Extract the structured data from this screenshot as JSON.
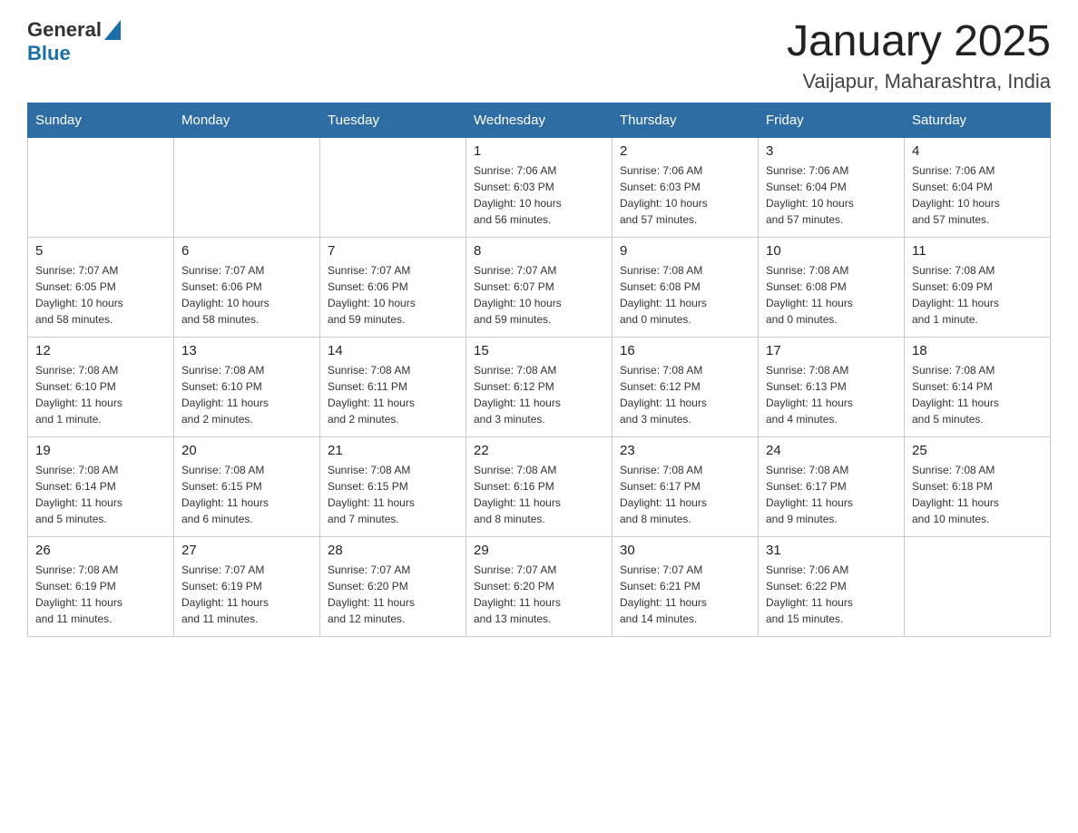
{
  "header": {
    "logo": {
      "text_general": "General",
      "text_blue": "Blue",
      "alt": "GeneralBlue logo"
    },
    "month_year": "January 2025",
    "location": "Vaijapur, Maharashtra, India"
  },
  "days_of_week": [
    "Sunday",
    "Monday",
    "Tuesday",
    "Wednesday",
    "Thursday",
    "Friday",
    "Saturday"
  ],
  "weeks": [
    {
      "days": [
        {
          "num": "",
          "info": ""
        },
        {
          "num": "",
          "info": ""
        },
        {
          "num": "",
          "info": ""
        },
        {
          "num": "1",
          "info": "Sunrise: 7:06 AM\nSunset: 6:03 PM\nDaylight: 10 hours\nand 56 minutes."
        },
        {
          "num": "2",
          "info": "Sunrise: 7:06 AM\nSunset: 6:03 PM\nDaylight: 10 hours\nand 57 minutes."
        },
        {
          "num": "3",
          "info": "Sunrise: 7:06 AM\nSunset: 6:04 PM\nDaylight: 10 hours\nand 57 minutes."
        },
        {
          "num": "4",
          "info": "Sunrise: 7:06 AM\nSunset: 6:04 PM\nDaylight: 10 hours\nand 57 minutes."
        }
      ]
    },
    {
      "days": [
        {
          "num": "5",
          "info": "Sunrise: 7:07 AM\nSunset: 6:05 PM\nDaylight: 10 hours\nand 58 minutes."
        },
        {
          "num": "6",
          "info": "Sunrise: 7:07 AM\nSunset: 6:06 PM\nDaylight: 10 hours\nand 58 minutes."
        },
        {
          "num": "7",
          "info": "Sunrise: 7:07 AM\nSunset: 6:06 PM\nDaylight: 10 hours\nand 59 minutes."
        },
        {
          "num": "8",
          "info": "Sunrise: 7:07 AM\nSunset: 6:07 PM\nDaylight: 10 hours\nand 59 minutes."
        },
        {
          "num": "9",
          "info": "Sunrise: 7:08 AM\nSunset: 6:08 PM\nDaylight: 11 hours\nand 0 minutes."
        },
        {
          "num": "10",
          "info": "Sunrise: 7:08 AM\nSunset: 6:08 PM\nDaylight: 11 hours\nand 0 minutes."
        },
        {
          "num": "11",
          "info": "Sunrise: 7:08 AM\nSunset: 6:09 PM\nDaylight: 11 hours\nand 1 minute."
        }
      ]
    },
    {
      "days": [
        {
          "num": "12",
          "info": "Sunrise: 7:08 AM\nSunset: 6:10 PM\nDaylight: 11 hours\nand 1 minute."
        },
        {
          "num": "13",
          "info": "Sunrise: 7:08 AM\nSunset: 6:10 PM\nDaylight: 11 hours\nand 2 minutes."
        },
        {
          "num": "14",
          "info": "Sunrise: 7:08 AM\nSunset: 6:11 PM\nDaylight: 11 hours\nand 2 minutes."
        },
        {
          "num": "15",
          "info": "Sunrise: 7:08 AM\nSunset: 6:12 PM\nDaylight: 11 hours\nand 3 minutes."
        },
        {
          "num": "16",
          "info": "Sunrise: 7:08 AM\nSunset: 6:12 PM\nDaylight: 11 hours\nand 3 minutes."
        },
        {
          "num": "17",
          "info": "Sunrise: 7:08 AM\nSunset: 6:13 PM\nDaylight: 11 hours\nand 4 minutes."
        },
        {
          "num": "18",
          "info": "Sunrise: 7:08 AM\nSunset: 6:14 PM\nDaylight: 11 hours\nand 5 minutes."
        }
      ]
    },
    {
      "days": [
        {
          "num": "19",
          "info": "Sunrise: 7:08 AM\nSunset: 6:14 PM\nDaylight: 11 hours\nand 5 minutes."
        },
        {
          "num": "20",
          "info": "Sunrise: 7:08 AM\nSunset: 6:15 PM\nDaylight: 11 hours\nand 6 minutes."
        },
        {
          "num": "21",
          "info": "Sunrise: 7:08 AM\nSunset: 6:15 PM\nDaylight: 11 hours\nand 7 minutes."
        },
        {
          "num": "22",
          "info": "Sunrise: 7:08 AM\nSunset: 6:16 PM\nDaylight: 11 hours\nand 8 minutes."
        },
        {
          "num": "23",
          "info": "Sunrise: 7:08 AM\nSunset: 6:17 PM\nDaylight: 11 hours\nand 8 minutes."
        },
        {
          "num": "24",
          "info": "Sunrise: 7:08 AM\nSunset: 6:17 PM\nDaylight: 11 hours\nand 9 minutes."
        },
        {
          "num": "25",
          "info": "Sunrise: 7:08 AM\nSunset: 6:18 PM\nDaylight: 11 hours\nand 10 minutes."
        }
      ]
    },
    {
      "days": [
        {
          "num": "26",
          "info": "Sunrise: 7:08 AM\nSunset: 6:19 PM\nDaylight: 11 hours\nand 11 minutes."
        },
        {
          "num": "27",
          "info": "Sunrise: 7:07 AM\nSunset: 6:19 PM\nDaylight: 11 hours\nand 11 minutes."
        },
        {
          "num": "28",
          "info": "Sunrise: 7:07 AM\nSunset: 6:20 PM\nDaylight: 11 hours\nand 12 minutes."
        },
        {
          "num": "29",
          "info": "Sunrise: 7:07 AM\nSunset: 6:20 PM\nDaylight: 11 hours\nand 13 minutes."
        },
        {
          "num": "30",
          "info": "Sunrise: 7:07 AM\nSunset: 6:21 PM\nDaylight: 11 hours\nand 14 minutes."
        },
        {
          "num": "31",
          "info": "Sunrise: 7:06 AM\nSunset: 6:22 PM\nDaylight: 11 hours\nand 15 minutes."
        },
        {
          "num": "",
          "info": ""
        }
      ]
    }
  ]
}
